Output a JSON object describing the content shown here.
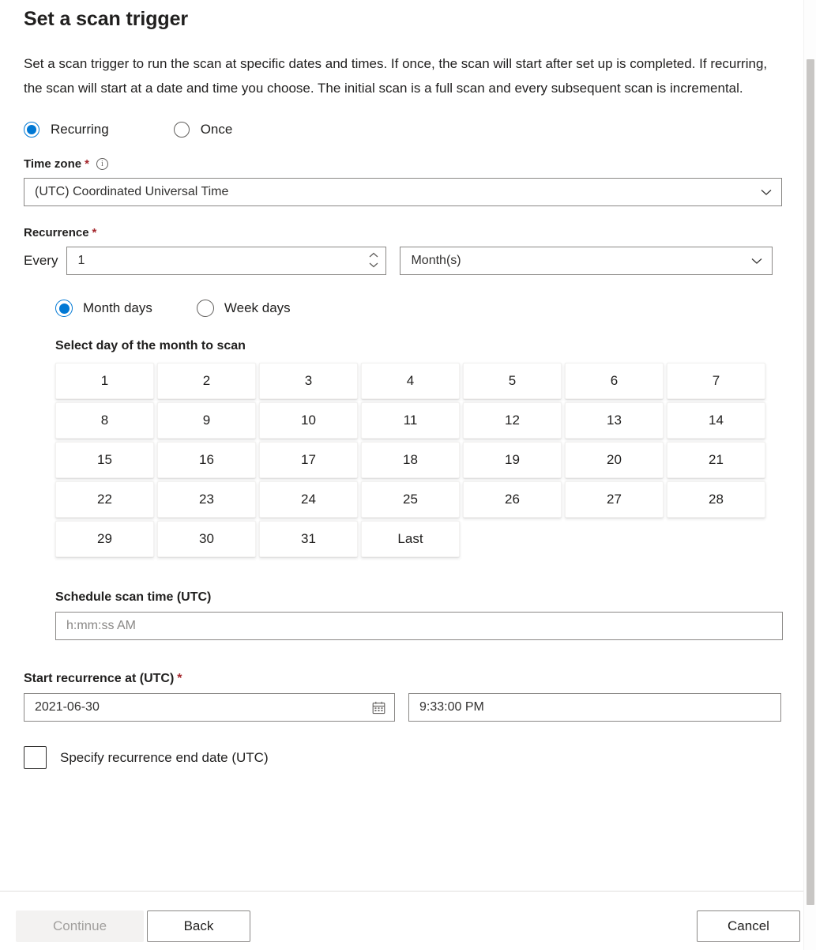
{
  "page": {
    "title": "Set a scan trigger",
    "description": "Set a scan trigger to run the scan at specific dates and times. If once, the scan will start after set up is completed. If recurring, the scan will start at a date and time you choose. The initial scan is a full scan and every subsequent scan is incremental."
  },
  "colors": {
    "accent": "#0078d4",
    "required_asterisk": "#a4262c",
    "border": "#8a8886",
    "disabled_bg": "#f3f2f1",
    "disabled_text": "#a19f9d",
    "scroll_thumb": "#c8c6c4"
  },
  "trigger_type": {
    "selected": "Recurring",
    "options": [
      {
        "label": "Recurring",
        "checked": true
      },
      {
        "label": "Once",
        "checked": false
      }
    ]
  },
  "time_zone": {
    "label": "Time zone",
    "required_mark": "*",
    "info_glyph": "i",
    "value": "(UTC) Coordinated Universal Time"
  },
  "recurrence": {
    "label": "Recurrence",
    "required_mark": "*",
    "every_label": "Every",
    "interval_value": "1",
    "unit_value": "Month(s)",
    "mode": {
      "selected": "Month days",
      "options": [
        {
          "label": "Month days",
          "checked": true
        },
        {
          "label": "Week days",
          "checked": false
        }
      ]
    },
    "day_picker": {
      "title": "Select day of the month to scan",
      "days": [
        "1",
        "2",
        "3",
        "4",
        "5",
        "6",
        "7",
        "8",
        "9",
        "10",
        "11",
        "12",
        "13",
        "14",
        "15",
        "16",
        "17",
        "18",
        "19",
        "20",
        "21",
        "22",
        "23",
        "24",
        "25",
        "26",
        "27",
        "28",
        "29",
        "30",
        "31",
        "Last"
      ]
    },
    "schedule_time": {
      "label": "Schedule scan time (UTC)",
      "value": "",
      "placeholder": "h:mm:ss AM"
    }
  },
  "start_recurrence": {
    "label": "Start recurrence at (UTC)",
    "required_mark": "*",
    "date_value": "2021-06-30",
    "time_value": "9:33:00 PM"
  },
  "end_date_checkbox": {
    "label": "Specify recurrence end date (UTC)",
    "checked": false
  },
  "footer": {
    "continue_label": "Continue",
    "continue_disabled": true,
    "back_label": "Back",
    "cancel_label": "Cancel"
  }
}
